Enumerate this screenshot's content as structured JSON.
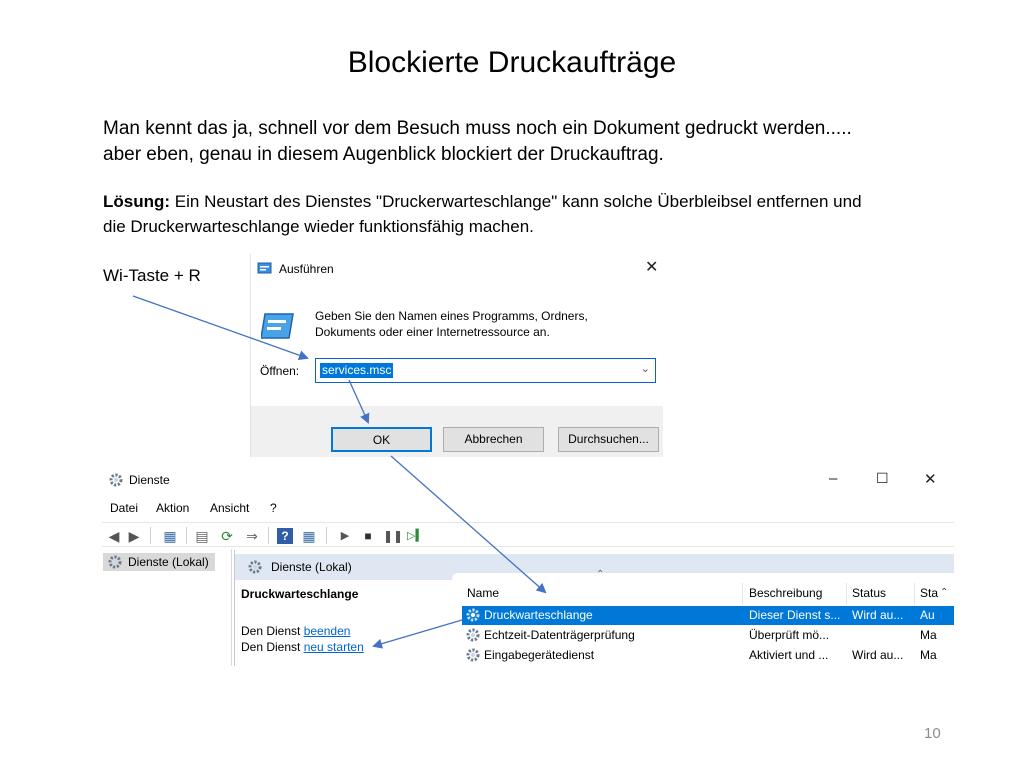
{
  "slide": {
    "title": "Blockierte Druckaufträge",
    "intro_line1": "Man kennt das ja, schnell vor dem Besuch muss noch ein Dokument gedruckt werden.....",
    "intro_line2": "aber eben, genau in diesem Augenblick blockiert der Druckauftrag.",
    "solution_label": "Lösung:",
    "solution_text1": " Ein Neustart des Dienstes \"Druckerwarteschlange\" kann solche Überbleibsel entfernen und",
    "solution_text2": "die Druckerwarteschlange wieder funktionsfähig machen.",
    "hotkey": "Wi-Taste + R",
    "page_number": "10"
  },
  "run_dialog": {
    "title": "Ausführen",
    "description_line1": "Geben Sie den Namen eines Programms, Ordners,",
    "description_line2": "Dokuments oder einer Internetressource an.",
    "open_label": "Öffnen:",
    "input_value": "services.msc",
    "ok_label": "OK",
    "cancel_label": "Abbrechen",
    "browse_label": "Durchsuchen..."
  },
  "services_window": {
    "title": "Dienste",
    "menu": [
      "Datei",
      "Aktion",
      "Ansicht",
      "?"
    ],
    "tree_item": "Dienste (Lokal)",
    "pane_header": "Dienste (Lokal)",
    "detail_title": "Druckwarteschlange",
    "detail_prefix1": "Den Dienst ",
    "detail_link1": "beenden",
    "detail_prefix2": "Den Dienst ",
    "detail_link2": "neu starten",
    "columns": [
      "Name",
      "Beschreibung",
      "Status",
      "Sta"
    ],
    "rows": [
      {
        "name": "Druckwarteschlange",
        "description": "Dieser Dienst s...",
        "status": "Wird au...",
        "start": "Au"
      },
      {
        "name": "Echtzeit-Datenträgerprüfung",
        "description": "Überprüft mö...",
        "status": "",
        "start": "Ma"
      },
      {
        "name": "Eingabegerätedienst",
        "description": "Aktiviert und ...",
        "status": "Wird au...",
        "start": "Ma"
      }
    ]
  },
  "colors": {
    "accent": "#0078d7",
    "arrow": "#4472c4",
    "link": "#0066cc",
    "pane_header": "#dfe8f2"
  }
}
